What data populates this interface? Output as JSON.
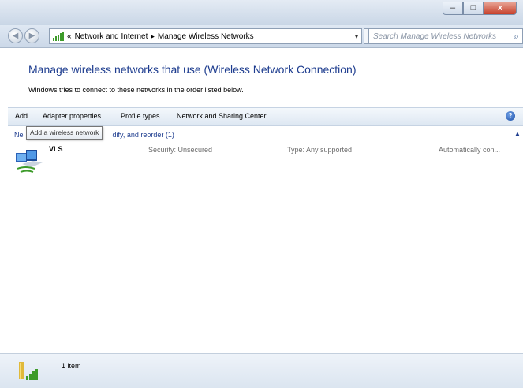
{
  "window": {
    "minimize_label": "–",
    "maximize_label": "□",
    "close_label": "x"
  },
  "nav": {
    "back_glyph": "◀",
    "forward_glyph": "▶",
    "breadcrumb_prefix": "«",
    "breadcrumb": [
      "Network and Internet",
      "Manage Wireless Networks"
    ],
    "breadcrumb_separator": "▸",
    "dropdown_glyph": "▾",
    "refresh_glyph": "↻",
    "search_placeholder": "Search Manage Wireless Networks",
    "search_icon": "magnifier-icon"
  },
  "header": {
    "title": "Manage wireless networks that use (Wireless Network Connection)",
    "subtitle": "Windows tries to connect to these networks in the order listed below."
  },
  "toolbar": {
    "items": [
      "Add",
      "Adapter properties",
      "Profile types",
      "Network and Sharing Center"
    ],
    "help_glyph": "?"
  },
  "group": {
    "header_visible": "dify, and reorder (1)",
    "header_prefix_visible": "Ne",
    "collapse_glyph": "▲"
  },
  "tooltip": {
    "text": "Add a wireless network"
  },
  "networks": [
    {
      "name": "VLS",
      "security": "Security: Unsecured",
      "type": "Type: Any supported",
      "mode": "Automatically con..."
    }
  ],
  "status": {
    "count_text": "1 item"
  },
  "colors": {
    "link_blue": "#1e3d8f",
    "signal_green": "#3d9b2a",
    "close_red": "#c7402a"
  }
}
